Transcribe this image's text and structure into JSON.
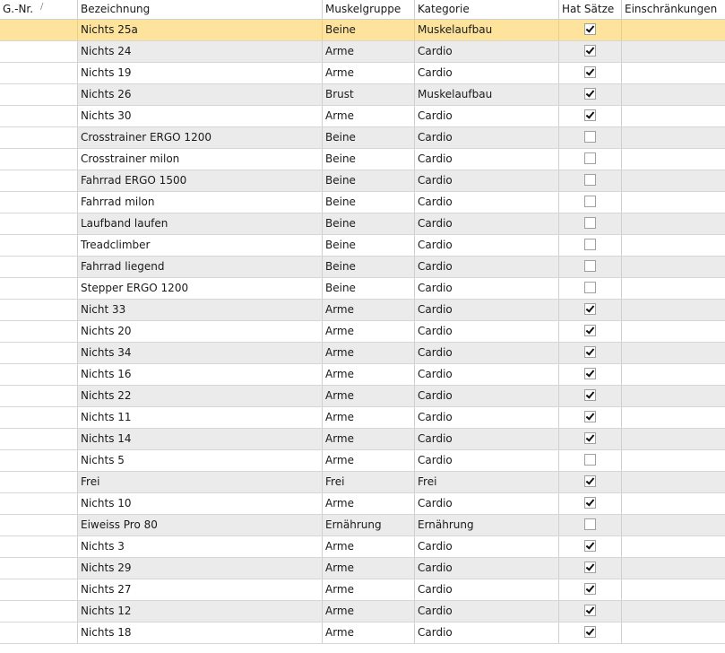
{
  "columns": {
    "nr": "G.-Nr.",
    "bezeichnung": "Bezeichnung",
    "muskelgruppe": "Muskelgruppe",
    "kategorie": "Kategorie",
    "hat_saetze": "Hat Sätze",
    "einschraenkungen": "Einschränkungen"
  },
  "sort_indicator": "/",
  "colors": {
    "selected_row": "#fde39b",
    "alt_row": "#ebebeb",
    "grid_line": "#d0d0d0"
  },
  "selected_row_index": 0,
  "rows": [
    {
      "nr": "",
      "bezeichnung": "Nichts 25a",
      "muskelgruppe": "Beine",
      "kategorie": "Muskelaufbau",
      "hat_saetze": true,
      "einschraenkungen": ""
    },
    {
      "nr": "",
      "bezeichnung": "Nichts 24",
      "muskelgruppe": "Arme",
      "kategorie": "Cardio",
      "hat_saetze": true,
      "einschraenkungen": ""
    },
    {
      "nr": "",
      "bezeichnung": "Nichts 19",
      "muskelgruppe": "Arme",
      "kategorie": "Cardio",
      "hat_saetze": true,
      "einschraenkungen": ""
    },
    {
      "nr": "",
      "bezeichnung": "Nichts 26",
      "muskelgruppe": "Brust",
      "kategorie": "Muskelaufbau",
      "hat_saetze": true,
      "einschraenkungen": ""
    },
    {
      "nr": "",
      "bezeichnung": "Nichts 30",
      "muskelgruppe": "Arme",
      "kategorie": "Cardio",
      "hat_saetze": true,
      "einschraenkungen": ""
    },
    {
      "nr": "",
      "bezeichnung": "Crosstrainer ERGO 1200",
      "muskelgruppe": "Beine",
      "kategorie": "Cardio",
      "hat_saetze": false,
      "einschraenkungen": ""
    },
    {
      "nr": "",
      "bezeichnung": "Crosstrainer milon",
      "muskelgruppe": "Beine",
      "kategorie": "Cardio",
      "hat_saetze": false,
      "einschraenkungen": ""
    },
    {
      "nr": "",
      "bezeichnung": "Fahrrad ERGO 1500",
      "muskelgruppe": "Beine",
      "kategorie": "Cardio",
      "hat_saetze": false,
      "einschraenkungen": ""
    },
    {
      "nr": "",
      "bezeichnung": "Fahrrad milon",
      "muskelgruppe": "Beine",
      "kategorie": "Cardio",
      "hat_saetze": false,
      "einschraenkungen": ""
    },
    {
      "nr": "",
      "bezeichnung": "Laufband laufen",
      "muskelgruppe": "Beine",
      "kategorie": "Cardio",
      "hat_saetze": false,
      "einschraenkungen": ""
    },
    {
      "nr": "",
      "bezeichnung": "Treadclimber",
      "muskelgruppe": "Beine",
      "kategorie": "Cardio",
      "hat_saetze": false,
      "einschraenkungen": ""
    },
    {
      "nr": "",
      "bezeichnung": "Fahrrad liegend",
      "muskelgruppe": "Beine",
      "kategorie": "Cardio",
      "hat_saetze": false,
      "einschraenkungen": ""
    },
    {
      "nr": "",
      "bezeichnung": "Stepper ERGO 1200",
      "muskelgruppe": "Beine",
      "kategorie": "Cardio",
      "hat_saetze": false,
      "einschraenkungen": ""
    },
    {
      "nr": "",
      "bezeichnung": "Nicht 33",
      "muskelgruppe": "Arme",
      "kategorie": "Cardio",
      "hat_saetze": true,
      "einschraenkungen": ""
    },
    {
      "nr": "",
      "bezeichnung": "Nichts 20",
      "muskelgruppe": "Arme",
      "kategorie": "Cardio",
      "hat_saetze": true,
      "einschraenkungen": ""
    },
    {
      "nr": "",
      "bezeichnung": "Nichts 34",
      "muskelgruppe": "Arme",
      "kategorie": "Cardio",
      "hat_saetze": true,
      "einschraenkungen": ""
    },
    {
      "nr": "",
      "bezeichnung": "Nichts 16",
      "muskelgruppe": "Arme",
      "kategorie": "Cardio",
      "hat_saetze": true,
      "einschraenkungen": ""
    },
    {
      "nr": "",
      "bezeichnung": "Nichts 22",
      "muskelgruppe": "Arme",
      "kategorie": "Cardio",
      "hat_saetze": true,
      "einschraenkungen": ""
    },
    {
      "nr": "",
      "bezeichnung": "Nichts 11",
      "muskelgruppe": "Arme",
      "kategorie": "Cardio",
      "hat_saetze": true,
      "einschraenkungen": ""
    },
    {
      "nr": "",
      "bezeichnung": "Nichts 14",
      "muskelgruppe": "Arme",
      "kategorie": "Cardio",
      "hat_saetze": true,
      "einschraenkungen": ""
    },
    {
      "nr": "",
      "bezeichnung": "Nichts 5",
      "muskelgruppe": "Arme",
      "kategorie": "Cardio",
      "hat_saetze": false,
      "einschraenkungen": ""
    },
    {
      "nr": "",
      "bezeichnung": "Frei",
      "muskelgruppe": "Frei",
      "kategorie": "Frei",
      "hat_saetze": true,
      "einschraenkungen": ""
    },
    {
      "nr": "",
      "bezeichnung": "Nichts 10",
      "muskelgruppe": "Arme",
      "kategorie": "Cardio",
      "hat_saetze": true,
      "einschraenkungen": ""
    },
    {
      "nr": "",
      "bezeichnung": "Eiweiss Pro 80",
      "muskelgruppe": "Ernährung",
      "kategorie": "Ernährung",
      "hat_saetze": false,
      "einschraenkungen": ""
    },
    {
      "nr": "",
      "bezeichnung": "Nichts 3",
      "muskelgruppe": "Arme",
      "kategorie": "Cardio",
      "hat_saetze": true,
      "einschraenkungen": ""
    },
    {
      "nr": "",
      "bezeichnung": "Nichts 29",
      "muskelgruppe": "Arme",
      "kategorie": "Cardio",
      "hat_saetze": true,
      "einschraenkungen": ""
    },
    {
      "nr": "",
      "bezeichnung": "Nichts 27",
      "muskelgruppe": "Arme",
      "kategorie": "Cardio",
      "hat_saetze": true,
      "einschraenkungen": ""
    },
    {
      "nr": "",
      "bezeichnung": "Nichts 12",
      "muskelgruppe": "Arme",
      "kategorie": "Cardio",
      "hat_saetze": true,
      "einschraenkungen": ""
    },
    {
      "nr": "",
      "bezeichnung": "Nichts 18",
      "muskelgruppe": "Arme",
      "kategorie": "Cardio",
      "hat_saetze": true,
      "einschraenkungen": ""
    }
  ]
}
